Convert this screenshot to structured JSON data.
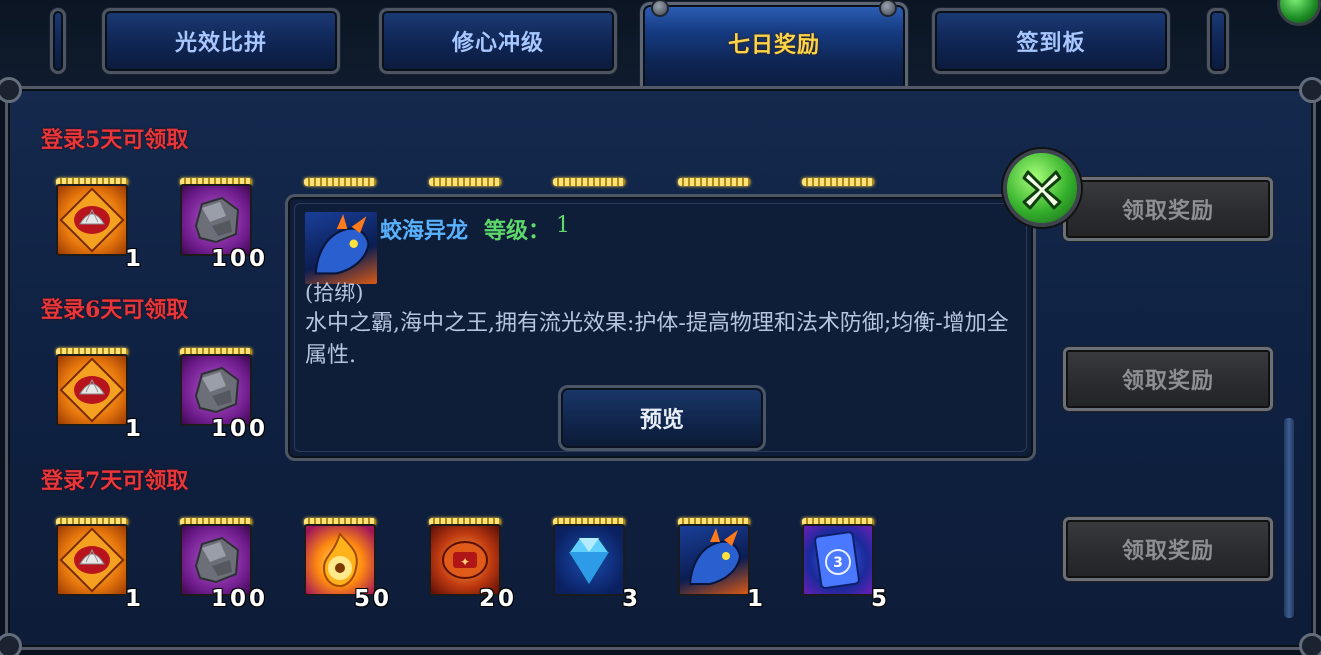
{
  "tabs": [
    {
      "label": "光效比拼",
      "active": false
    },
    {
      "label": "修心冲级",
      "active": false
    },
    {
      "label": "七日奖励",
      "active": true
    },
    {
      "label": "签到板",
      "active": false
    }
  ],
  "rows": [
    {
      "title": "登录5天可领取",
      "button": "领取奖励",
      "items": [
        {
          "icon": "shell-icon",
          "qty": "1"
        },
        {
          "icon": "ore-icon",
          "qty": "100"
        }
      ]
    },
    {
      "title": "登录6天可领取",
      "button": "领取奖励",
      "items": [
        {
          "icon": "shell-icon",
          "qty": "1"
        },
        {
          "icon": "ore-icon",
          "qty": "100"
        }
      ]
    },
    {
      "title": "登录7天可领取",
      "button": "领取奖励",
      "items": [
        {
          "icon": "shell-icon",
          "qty": "1"
        },
        {
          "icon": "ore-icon",
          "qty": "100"
        },
        {
          "icon": "fire-icon",
          "qty": "50"
        },
        {
          "icon": "seal-icon",
          "qty": "20"
        },
        {
          "icon": "gem-icon",
          "qty": "3"
        },
        {
          "icon": "dragon-icon",
          "qty": "1"
        },
        {
          "icon": "card-icon",
          "qty": "5"
        }
      ]
    }
  ],
  "popup": {
    "icon": "dragon-icon",
    "name": "蛟海异龙",
    "level_label": "等级：",
    "level_value": "1",
    "bind": "(拾绑)",
    "description": "水中之霸,海中之王,拥有流光效果:护体-提高物理和法术防御;均衡-增加全属性.",
    "preview_label": "预览",
    "close_icon": "close-icon"
  },
  "colors": {
    "active_tab": "#ffd34a",
    "row_title": "#e8373a",
    "item_name": "#58b2ff",
    "level": "#5dd86a"
  }
}
